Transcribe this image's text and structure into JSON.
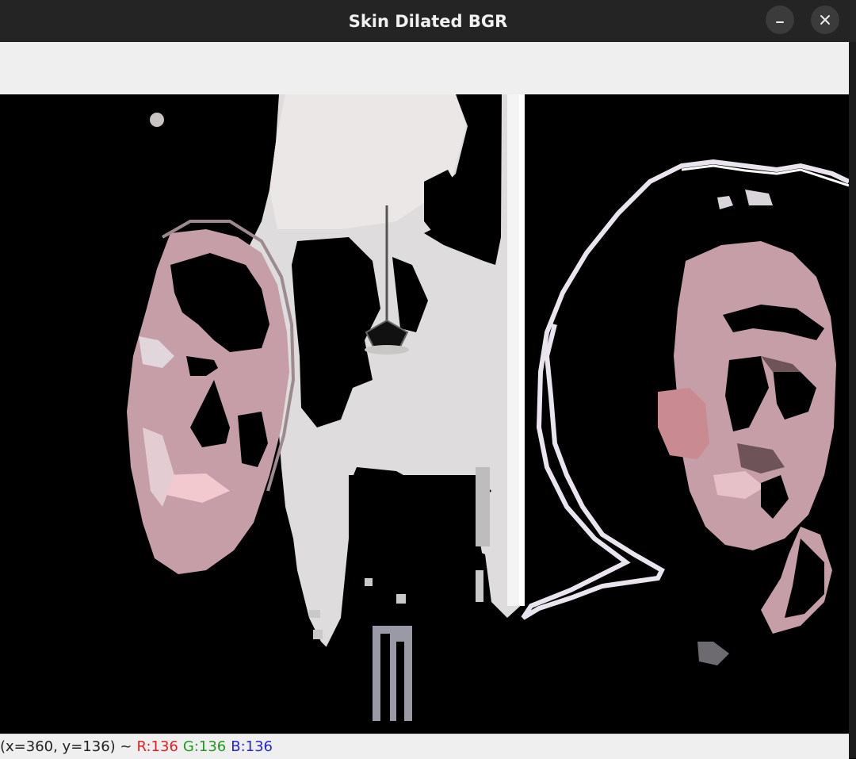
{
  "window": {
    "title": "Skin Dilated BGR",
    "minimize_icon": "minus-icon",
    "close_icon": "close-icon"
  },
  "image": {
    "description_icon": "image-canvas",
    "colors": {
      "background": "#000000",
      "skin": "#c9a3ab",
      "wall": "#dcdcdc",
      "ceiling": "#e8e4e4",
      "outline": "#e9e4ee"
    }
  },
  "status": {
    "coords": "(x=360, y=136) ~",
    "r": "R:136",
    "g": "G:136",
    "b": "B:136",
    "colors": {
      "r": "#e0201f",
      "g": "#1f9a1f",
      "b": "#2525d8"
    }
  }
}
